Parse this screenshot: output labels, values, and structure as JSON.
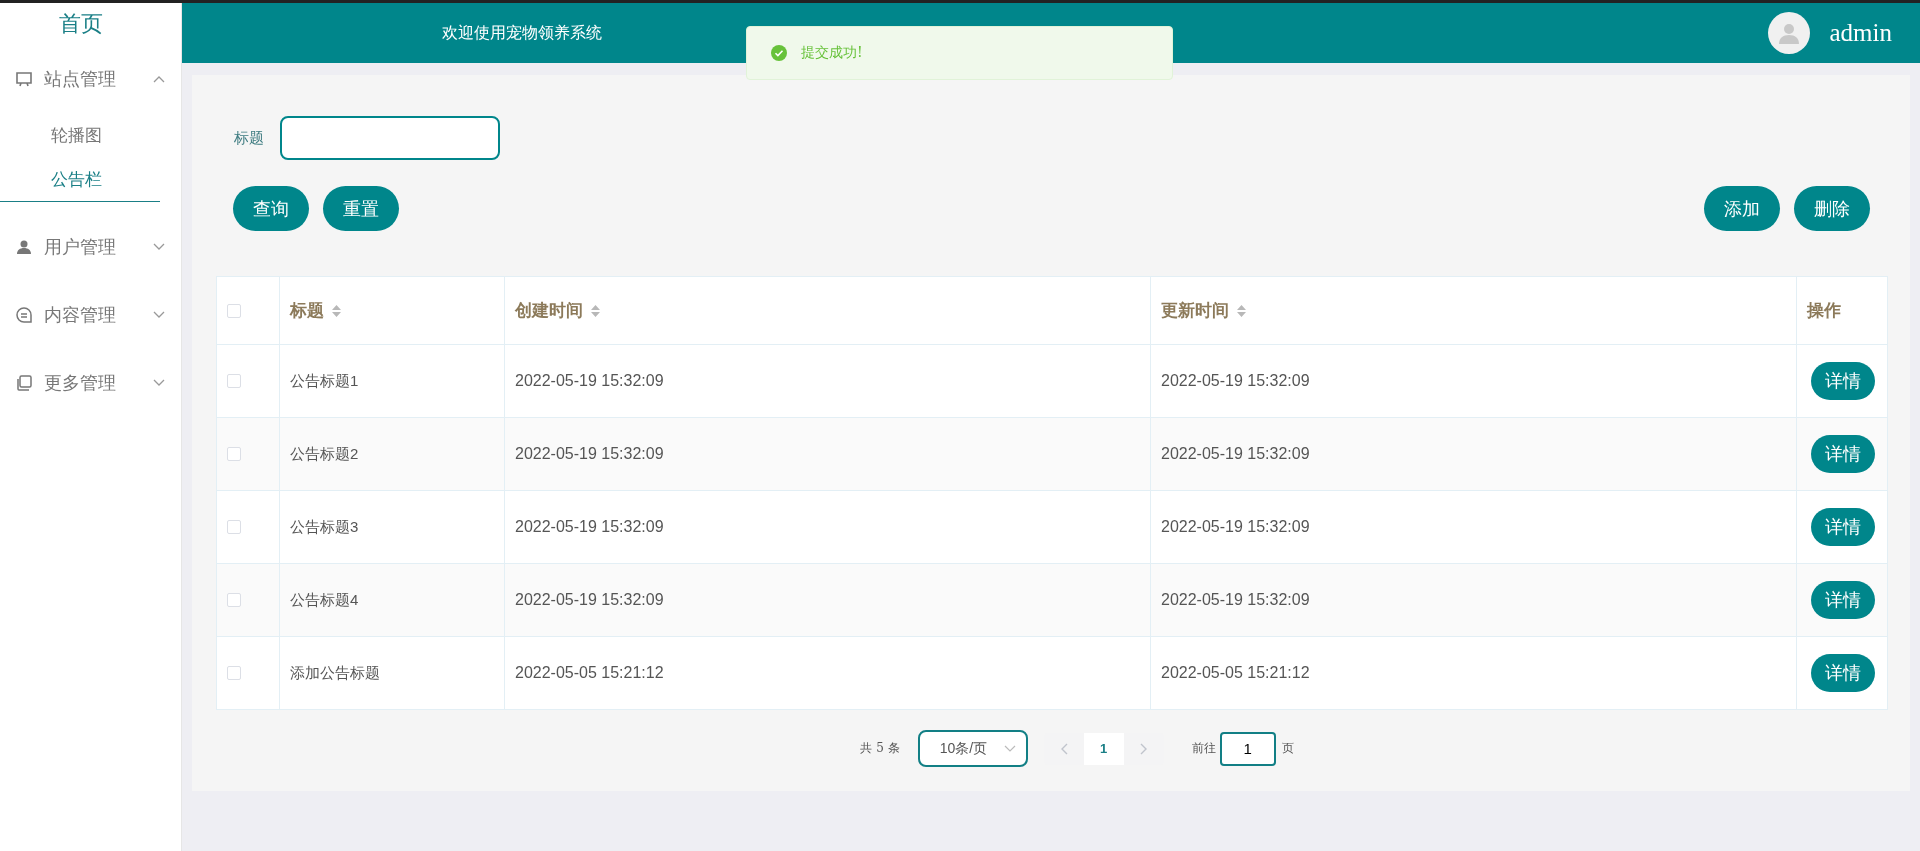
{
  "sidebar": {
    "home": "首页",
    "menus": [
      {
        "label": "站点管理",
        "expanded": true,
        "children": [
          {
            "label": "轮播图",
            "selected": false
          },
          {
            "label": "公告栏",
            "selected": true
          }
        ]
      },
      {
        "label": "用户管理",
        "expanded": false
      },
      {
        "label": "内容管理",
        "expanded": false
      },
      {
        "label": "更多管理",
        "expanded": false
      }
    ]
  },
  "header": {
    "title": "欢迎使用宠物领养系统",
    "user": "admin"
  },
  "toast": {
    "kind": "success",
    "text": "提交成功!"
  },
  "search": {
    "fields": [
      {
        "label": "标题"
      }
    ],
    "left_buttons": [
      "查询",
      "重置"
    ],
    "right_buttons": [
      "添加",
      "删除"
    ]
  },
  "table": {
    "all_checked": false,
    "columns": [
      {
        "label": "标题",
        "sortable": true
      },
      {
        "label": "创建时间",
        "sortable": true
      },
      {
        "label": "更新时间",
        "sortable": true
      },
      {
        "label": "操作",
        "sortable": false
      }
    ],
    "rows": [
      {
        "checked": false,
        "cells": [
          "公告标题1",
          "2022-05-19 15:32:09",
          "2022-05-19 15:32:09"
        ],
        "action": "详情"
      },
      {
        "checked": false,
        "cells": [
          "公告标题2",
          "2022-05-19 15:32:09",
          "2022-05-19 15:32:09"
        ],
        "action": "详情"
      },
      {
        "checked": false,
        "cells": [
          "公告标题3",
          "2022-05-19 15:32:09",
          "2022-05-19 15:32:09"
        ],
        "action": "详情"
      },
      {
        "checked": false,
        "cells": [
          "公告标题4",
          "2022-05-19 15:32:09",
          "2022-05-19 15:32:09"
        ],
        "action": "详情"
      },
      {
        "checked": false,
        "cells": [
          "添加公告标题",
          "2022-05-05 15:21:12",
          "2022-05-05 15:21:12"
        ],
        "action": "详情"
      }
    ]
  },
  "pagination": {
    "total": "共 5 条",
    "page_size": "10条/页",
    "pages": [
      {
        "label": "1",
        "selected": true
      }
    ],
    "goto_label": "前往",
    "goto_value": "1",
    "goto_suffix": "页"
  }
}
